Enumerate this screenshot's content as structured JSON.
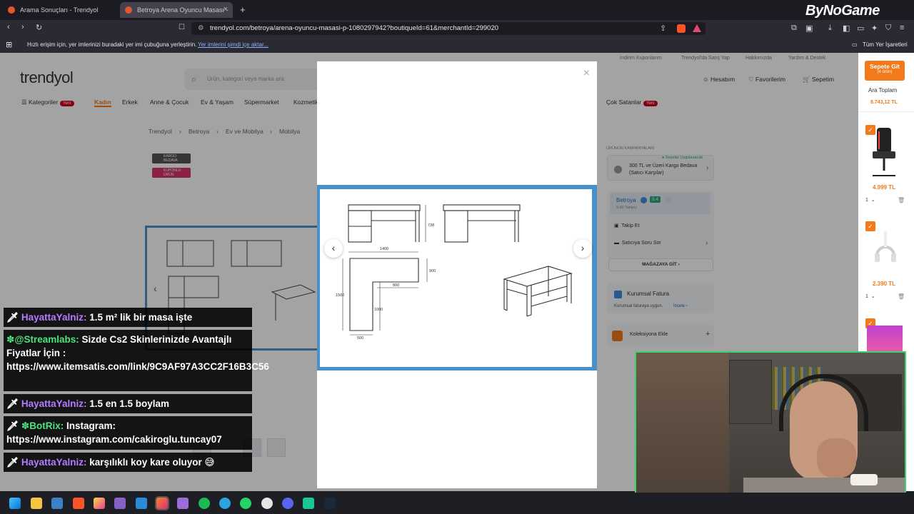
{
  "browser": {
    "tabs": [
      {
        "title": "Arama Sonuçları - Trendyol"
      },
      {
        "title": "Betroya Arena Oyuncu Masası -"
      }
    ],
    "url": "trendyol.com/betroya/arena-oyuncu-masasi-p-1080297942?boutiqueId=61&merchantId=299020",
    "bookmarks_text": "Hızlı erişim için, yer imlerinizi buradaki yer imi çubuğuna yerleştirin.",
    "bookmarks_link": "Yer imlerini şimdi içe aktar...",
    "all_bookmarks": "Tüm Yer İşaretleri"
  },
  "watermark": "ByNoGame",
  "site": {
    "logo": "trendyol",
    "search_placeholder": "Ürün, kategori veya marka ara",
    "toplinks": [
      "İndirim Kuponlarım",
      "Trendyol'da Satış Yap",
      "Hakkımızda",
      "Yardım & Destek"
    ],
    "account": {
      "hesabim": "Hesabım",
      "favoriler": "Favorilerim",
      "sepetim": "Sepetim",
      "cart_count": "4"
    },
    "categories": [
      "Kategoriler",
      "Kadın",
      "Erkek",
      "Anne & Çocuk",
      "Ev & Yaşam",
      "Süpermarket",
      "Kozmetik",
      "Çok Satanlar"
    ],
    "new_badge": "Yeni",
    "breadcrumb": [
      "Trendyol",
      "Betroya",
      "Ev ve Mobilya",
      "Mobilya"
    ],
    "badges": {
      "kargo": "KARGO BEDAVA",
      "kupon": "KUPONLU ÜRÜN"
    },
    "campaign_title": "ÜRÜNÜN KAMPANYALARI",
    "campaign_applied": "Sepette Uygulanacak",
    "campaign_text": "300 TL ve Üzeri Kargo Bedava (Satıcı Karşılar)",
    "seller": {
      "name": "Betroya",
      "score": "9.4",
      "followers": "9,90 Takipçi"
    },
    "follow": "Takip Et",
    "ask": "Satıcıya Soru Sor",
    "store": "MAĞAZAYA GİT",
    "invoice_title": "Kurumsal Fatura",
    "invoice_text": "Kurumsal faturaya uygun.",
    "invoice_link": "İncele",
    "collection": "Koleksiyona Ekle"
  },
  "cart": {
    "go_label": "Sepete Git",
    "count_label": "(4 ürün)",
    "subtotal_label": "Ara Toplam",
    "subtotal": "8.743,12 TL",
    "items": [
      {
        "price": "4.999 TL",
        "qty": "1"
      },
      {
        "price": "2.390 TL",
        "qty": "1"
      }
    ]
  },
  "modal": {
    "dims": {
      "top_width": "1400",
      "height": "738",
      "depth": "900",
      "inner": "800",
      "side": "1500",
      "side2": "1000",
      "leg": "500"
    }
  },
  "chat": [
    {
      "user": "HayattaYalniz:",
      "text": "1.5 m² lik bir masa işte"
    },
    {
      "user": "@Streamlabs:",
      "text": "Sizde Cs2 Skinlerinizde Avantajlı Fiyatlar İçin : https://www.itemsatis.com/link/9C9AF97A3CC2F16B3C56"
    },
    {
      "user": "HayattaYalniz:",
      "text": "1.5 en 1.5 boylam"
    },
    {
      "user": "BotRix:",
      "text": "Instagram: https://www.instagram.com/cakiroglu.tuncay07"
    },
    {
      "user": "HayattaYalniz:",
      "text": "karşılıklı koy kare oluyor 😅"
    }
  ],
  "colors": {
    "accent": "#f27a1a",
    "chat_user": "#b57cff",
    "webcam_border": "#3bd36b",
    "image_frame": "#4a90c8"
  }
}
